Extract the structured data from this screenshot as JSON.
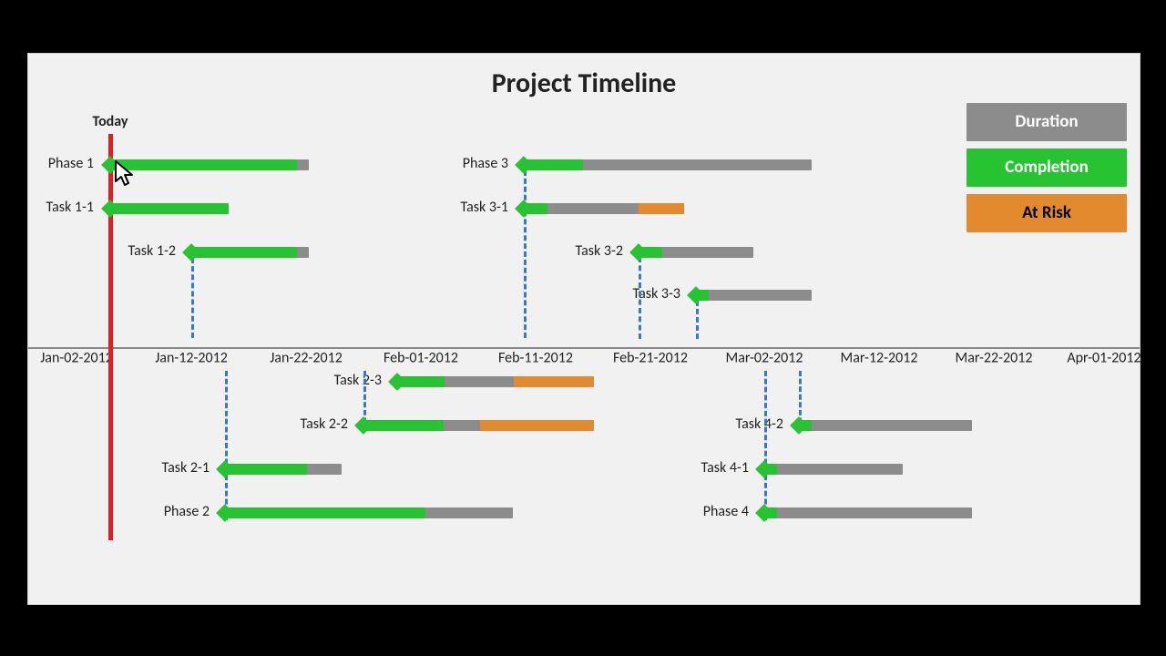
{
  "title": "Project Timeline",
  "today_label": "Today",
  "legend": {
    "duration": "Duration",
    "completion": "Completion",
    "at_risk": "At Risk"
  },
  "axis_labels": [
    "Jan-02-2012",
    "Jan-12-2012",
    "Jan-22-2012",
    "Feb-01-2012",
    "Feb-11-2012",
    "Feb-21-2012",
    "Mar-02-2012",
    "Mar-12-2012",
    "Mar-22-2012",
    "Apr-01-2012"
  ],
  "tasks": {
    "phase1": "Phase 1",
    "task1_1": "Task 1-1",
    "task1_2": "Task 1-2",
    "phase2": "Phase 2",
    "task2_1": "Task 2-1",
    "task2_2": "Task 2-2",
    "task2_3": "Task 2-3",
    "phase3": "Phase 3",
    "task3_1": "Task 3-1",
    "task3_2": "Task 3-2",
    "task3_3": "Task 3-3",
    "phase4": "Phase 4",
    "task4_1": "Task 4-1",
    "task4_2": "Task 4-2"
  },
  "chart_data": {
    "type": "bar",
    "title": "Project Timeline",
    "xlabel": "",
    "ylabel": "",
    "x_ticks": [
      "Jan-02-2012",
      "Jan-12-2012",
      "Jan-22-2012",
      "Feb-01-2012",
      "Feb-11-2012",
      "Feb-21-2012",
      "Mar-02-2012",
      "Mar-12-2012",
      "Mar-22-2012",
      "Apr-01-2012"
    ],
    "today": "Jan-03-2012",
    "legend": [
      "Duration",
      "Completion",
      "At Risk"
    ],
    "colors": {
      "duration": "#8c8c8c",
      "completion": "#28c332",
      "at_risk": "#e38a2e",
      "today_line": "#e02020",
      "dependency_line": "#3a78c9"
    },
    "tasks": [
      {
        "name": "Phase 1",
        "start": "Jan-03-2012",
        "end": "Jan-20-2012",
        "completion_end": "Jan-19-2012",
        "at_risk": false
      },
      {
        "name": "Task 1-1",
        "start": "Jan-03-2012",
        "end": "Jan-13-2012",
        "completion_end": "Jan-13-2012",
        "at_risk": false
      },
      {
        "name": "Task 1-2",
        "start": "Jan-10-2012",
        "end": "Jan-20-2012",
        "completion_end": "Jan-19-2012",
        "at_risk": false
      },
      {
        "name": "Phase 3",
        "start": "Feb-07-2012",
        "end": "Mar-02-2012",
        "completion_end": "Feb-12-2012",
        "at_risk": false
      },
      {
        "name": "Task 3-1",
        "start": "Feb-07-2012",
        "end": "Feb-21-2012",
        "completion_end": "Feb-09-2012",
        "at_risk": true,
        "at_risk_start": "Feb-17-2012"
      },
      {
        "name": "Task 3-2",
        "start": "Feb-17-2012",
        "end": "Feb-27-2012",
        "completion_end": "Feb-19-2012",
        "at_risk": false
      },
      {
        "name": "Task 3-3",
        "start": "Feb-23-2012",
        "end": "Mar-02-2012",
        "completion_end": "Feb-24-2012",
        "at_risk": false
      },
      {
        "name": "Phase 2",
        "start": "Jan-13-2012",
        "end": "Feb-07-2012",
        "completion_end": "Jan-30-2012",
        "at_risk": false
      },
      {
        "name": "Task 2-1",
        "start": "Jan-13-2012",
        "end": "Jan-23-2012",
        "completion_end": "Jan-20-2012",
        "at_risk": false
      },
      {
        "name": "Task 2-2",
        "start": "Jan-25-2012",
        "end": "Feb-13-2012",
        "completion_end": "Jan-31-2012",
        "at_risk": true,
        "at_risk_start": "Feb-03-2012"
      },
      {
        "name": "Task 2-3",
        "start": "Jan-27-2012",
        "end": "Feb-13-2012",
        "completion_end": "Jan-31-2012",
        "at_risk": true,
        "at_risk_start": "Feb-06-2012"
      },
      {
        "name": "Phase 4",
        "start": "Feb-28-2012",
        "end": "Mar-17-2012",
        "completion_end": "Feb-29-2012",
        "at_risk": false
      },
      {
        "name": "Task 4-1",
        "start": "Feb-28-2012",
        "end": "Mar-10-2012",
        "completion_end": "Feb-29-2012",
        "at_risk": false
      },
      {
        "name": "Task 4-2",
        "start": "Mar-03-2012",
        "end": "Mar-17-2012",
        "completion_end": "Mar-04-2012",
        "at_risk": false
      }
    ]
  }
}
